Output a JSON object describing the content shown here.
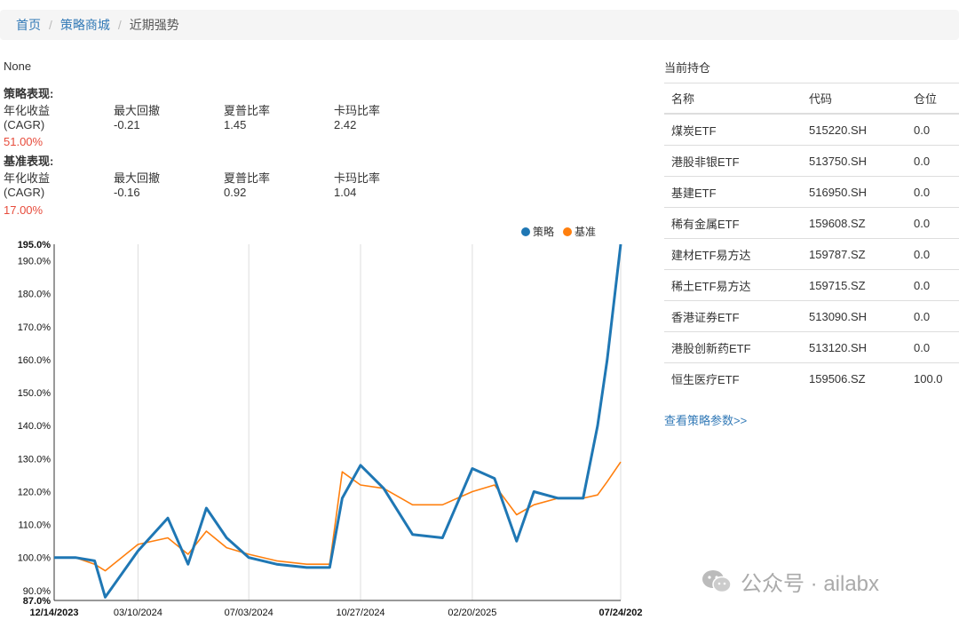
{
  "breadcrumb": {
    "home": "首页",
    "mall": "策略商城",
    "current": "近期强势"
  },
  "strategy_name": "None",
  "strategy_perf": {
    "title": "策略表现:",
    "labels": {
      "cagr_line1": "年化收益",
      "cagr_line2": "(CAGR)",
      "drawdown": "最大回撤",
      "sharpe": "夏普比率",
      "calmar": "卡玛比率"
    },
    "cagr": "51.00%",
    "drawdown": "-0.21",
    "sharpe": "1.45",
    "calmar": "2.42"
  },
  "benchmark_perf": {
    "title": "基准表现:",
    "labels": {
      "cagr_line1": "年化收益",
      "cagr_line2": "(CAGR)",
      "drawdown": "最大回撤",
      "sharpe": "夏普比率",
      "calmar": "卡玛比率"
    },
    "cagr": "17.00%",
    "drawdown": "-0.16",
    "sharpe": "0.92",
    "calmar": "1.04"
  },
  "holdings": {
    "title": "当前持仓",
    "headers": [
      "名称",
      "代码",
      "仓位"
    ],
    "rows": [
      [
        "煤炭ETF",
        "515220.SH",
        "0.0"
      ],
      [
        "港股非银ETF",
        "513750.SH",
        "0.0"
      ],
      [
        "基建ETF",
        "516950.SH",
        "0.0"
      ],
      [
        "稀有金属ETF",
        "159608.SZ",
        "0.0"
      ],
      [
        "建材ETF易方达",
        "159787.SZ",
        "0.0"
      ],
      [
        "稀土ETF易方达",
        "159715.SZ",
        "0.0"
      ],
      [
        "香港证券ETF",
        "513090.SH",
        "0.0"
      ],
      [
        "港股创新药ETF",
        "513120.SH",
        "0.0"
      ],
      [
        "恒生医疗ETF",
        "159506.SZ",
        "100.0"
      ]
    ],
    "link": "查看策略参数>>"
  },
  "watermark": "公众号 · ailabx",
  "chart_data": {
    "type": "line",
    "title": "",
    "xlabel": "",
    "ylabel": "",
    "ylim": [
      87,
      195
    ],
    "yticks": [
      "195.0%",
      "190.0%",
      "180.0%",
      "170.0%",
      "160.0%",
      "150.0%",
      "140.0%",
      "130.0%",
      "120.0%",
      "110.0%",
      "100.0%",
      "90.0%",
      "87.0%"
    ],
    "ytick_values": [
      195,
      190,
      180,
      170,
      160,
      150,
      140,
      130,
      120,
      110,
      100,
      90,
      87
    ],
    "xticks": [
      "12/14/2023",
      "03/10/2024",
      "07/03/2024",
      "10/27/2024",
      "02/20/2025",
      "07/24/202"
    ],
    "legend": "top-right",
    "colors": {
      "strategy": "#1f77b4",
      "benchmark": "#ff7f0e"
    },
    "series": [
      {
        "name": "策略",
        "x": [
          "12/14/2023",
          "01/05/2024",
          "01/25/2024",
          "02/05/2024",
          "03/10/2024",
          "04/10/2024",
          "05/01/2024",
          "05/20/2024",
          "06/10/2024",
          "07/03/2024",
          "08/01/2024",
          "09/01/2024",
          "09/25/2024",
          "10/08/2024",
          "10/27/2024",
          "11/20/2024",
          "12/20/2024",
          "01/20/2025",
          "02/20/2025",
          "03/15/2025",
          "04/07/2025",
          "04/25/2025",
          "05/20/2025",
          "06/15/2025",
          "06/30/2025",
          "07/10/2025",
          "07/24/2025"
        ],
        "values": [
          100,
          100,
          99,
          88,
          102,
          112,
          98,
          115,
          106,
          100,
          98,
          97,
          97,
          118,
          128,
          121,
          107,
          106,
          127,
          124,
          105,
          120,
          118,
          118,
          140,
          160,
          195
        ]
      },
      {
        "name": "基准",
        "x": [
          "12/14/2023",
          "01/05/2024",
          "01/25/2024",
          "02/05/2024",
          "03/10/2024",
          "04/10/2024",
          "05/01/2024",
          "05/20/2024",
          "06/10/2024",
          "07/03/2024",
          "08/01/2024",
          "09/01/2024",
          "09/25/2024",
          "10/08/2024",
          "10/27/2024",
          "11/20/2024",
          "12/20/2024",
          "01/20/2025",
          "02/20/2025",
          "03/15/2025",
          "04/07/2025",
          "04/25/2025",
          "05/20/2025",
          "06/15/2025",
          "06/30/2025",
          "07/10/2025",
          "07/24/2025"
        ],
        "values": [
          100,
          100,
          98,
          96,
          104,
          106,
          101,
          108,
          103,
          101,
          99,
          98,
          98,
          126,
          122,
          121,
          116,
          116,
          120,
          122,
          113,
          116,
          118,
          118,
          119,
          123,
          129
        ]
      }
    ]
  }
}
